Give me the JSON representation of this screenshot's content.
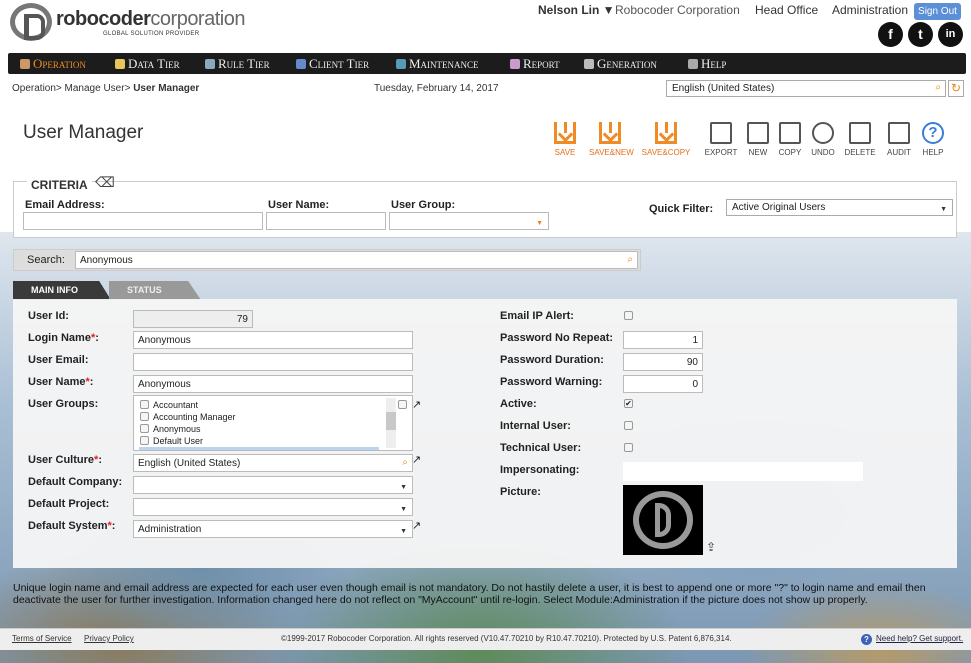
{
  "header": {
    "logo_bold": "robocoder",
    "logo_rest": "corporation",
    "logo_sub": "GLOBAL SOLUTION PROVIDER",
    "user": "Nelson Lin ▼",
    "company": "Robocoder Corporation",
    "office": "Head Office",
    "module": "Administration",
    "signout": "Sign Out",
    "social": [
      "f",
      "t",
      "in"
    ]
  },
  "menu": [
    {
      "label": "Operation",
      "active": true
    },
    {
      "label": "Data Tier"
    },
    {
      "label": "Rule Tier"
    },
    {
      "label": "Client Tier"
    },
    {
      "label": "Maintenance"
    },
    {
      "label": "Report"
    },
    {
      "label": "Generation"
    },
    {
      "label": "Help"
    }
  ],
  "breadcrumb": {
    "path": "Operation> Manage User> ",
    "current": "User Manager"
  },
  "date": "Tuesday, February 14, 2017",
  "language": "English (United States)",
  "page_title": "User Manager",
  "toolbar": [
    "SAVE",
    "SAVE&NEW",
    "SAVE&COPY",
    "EXPORT",
    "NEW",
    "COPY",
    "UNDO",
    "DELETE",
    "AUDIT",
    "HELP"
  ],
  "criteria": {
    "title": "CRITERIA",
    "email_label": "Email Address:",
    "username_label": "User Name:",
    "group_label": "User Group:",
    "quick_filter_label": "Quick Filter:",
    "quick_filter_value": "Active Original Users"
  },
  "search": {
    "label": "Search:",
    "value": "Anonymous"
  },
  "tabs": [
    "MAIN INFO",
    "STATUS"
  ],
  "form_left": {
    "user_id_label": "User Id:",
    "user_id": "79",
    "login_label": "Login Name",
    "login": "Anonymous",
    "email_label": "User Email:",
    "email": "",
    "username_label": "User Name",
    "username": "Anonymous",
    "groups_label": "User Groups:",
    "groups": [
      "Accountant",
      "Accounting Manager",
      "Anonymous",
      "Default User"
    ],
    "culture_label": "User Culture",
    "culture": "English (United States)",
    "company_label": "Default Company:",
    "company": "",
    "project_label": "Default Project:",
    "project": "",
    "system_label": "Default System",
    "system": "Administration"
  },
  "form_right": {
    "email_ip_label": "Email IP Alert:",
    "pwd_norepeat_label": "Password No Repeat:",
    "pwd_norepeat": "1",
    "pwd_duration_label": "Password Duration:",
    "pwd_duration": "90",
    "pwd_warning_label": "Password Warning:",
    "pwd_warning": "0",
    "active_label": "Active:",
    "internal_label": "Internal User:",
    "technical_label": "Technical User:",
    "impersonating_label": "Impersonating:",
    "picture_label": "Picture:"
  },
  "footnote": "Unique login name and email address are expected for each user even though email is not mandatory. Do not hastily delete a user, it is best to append one or more \"?\" to login name and email then deactivate the user for further investigation. Information changed here do not reflect on \"MyAccount\" until re-login. Select Module:Administration if the picture does not show up properly.",
  "footer": {
    "terms": "Terms of Service",
    "privacy": "Privacy Policy",
    "copyright": "©1999-2017 Robocoder Corporation. All rights reserved (V10.47.70210 by R10.47.70210). Protected by U.S. Patent 6,876,314.",
    "support": "Need help? Get support."
  }
}
